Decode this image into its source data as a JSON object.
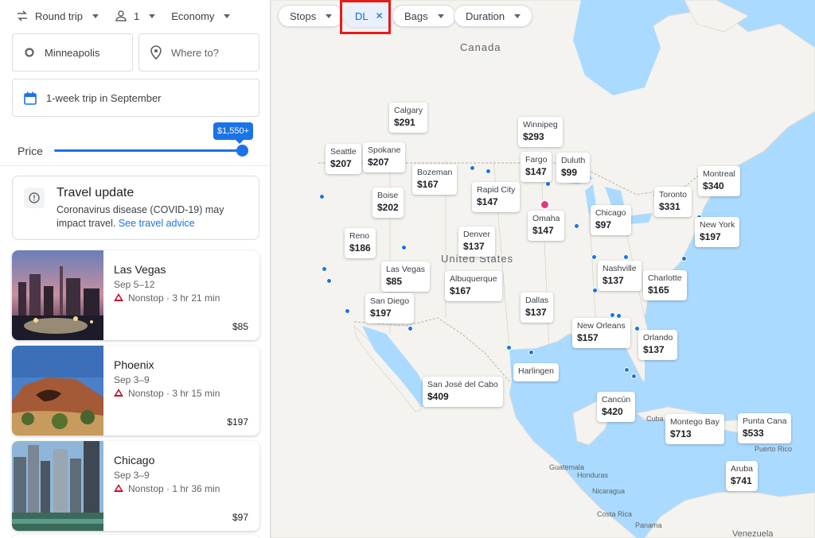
{
  "search": {
    "trip_type": "Round trip",
    "passengers": "1",
    "cabin": "Economy",
    "origin": "Minneapolis",
    "destination_placeholder": "Where to?",
    "dates": "1-week trip in September",
    "price_label": "Price",
    "price_max": "$1,550+"
  },
  "travel_update": {
    "title": "Travel update",
    "body": "Coronavirus disease (COVID-19) may impact travel.",
    "link": "See travel advice"
  },
  "results": [
    {
      "city": "Las Vegas",
      "dates": "Sep 5–12",
      "flight": "Nonstop · 3 hr 21 min",
      "price": "$85"
    },
    {
      "city": "Phoenix",
      "dates": "Sep 3–9",
      "flight": "Nonstop · 3 hr 15 min",
      "price": "$197"
    },
    {
      "city": "Chicago",
      "dates": "Sep 3–9",
      "flight": "Nonstop · 1 hr 36 min",
      "price": "$97"
    }
  ],
  "filters": {
    "stops": "Stops",
    "airline": "DL",
    "bags": "Bags",
    "duration": "Duration"
  },
  "map_labels": {
    "canada": "Canada",
    "us": "United States",
    "cuba": "Cuba",
    "puerto_rico": "Puerto Rico",
    "guatemala": "Guatemala",
    "honduras": "Honduras",
    "nicaragua": "Nicaragua",
    "costa_rica": "Costa Rica",
    "panama": "Panama",
    "venezuela": "Venezuela"
  },
  "destinations": [
    {
      "name": "Calgary",
      "price": "$291"
    },
    {
      "name": "Winnipeg",
      "price": "$293"
    },
    {
      "name": "Seattle",
      "price": "$207"
    },
    {
      "name": "Spokane",
      "price": "$207"
    },
    {
      "name": "Fargo",
      "price": "$147"
    },
    {
      "name": "Duluth",
      "price": "$99"
    },
    {
      "name": "Bozeman",
      "price": "$167"
    },
    {
      "name": "Montreal",
      "price": "$340"
    },
    {
      "name": "Boise",
      "price": "$202"
    },
    {
      "name": "Rapid City",
      "price": "$147"
    },
    {
      "name": "Toronto",
      "price": "$331"
    },
    {
      "name": "Omaha",
      "price": "$147"
    },
    {
      "name": "Chicago",
      "price": "$97"
    },
    {
      "name": "New York",
      "price": "$197"
    },
    {
      "name": "Reno",
      "price": "$186"
    },
    {
      "name": "Denver",
      "price": "$137"
    },
    {
      "name": "Las Vegas",
      "price": "$85"
    },
    {
      "name": "Nashville",
      "price": "$137"
    },
    {
      "name": "Charlotte",
      "price": "$165"
    },
    {
      "name": "Albuquerque",
      "price": "$167"
    },
    {
      "name": "San Diego",
      "price": "$197"
    },
    {
      "name": "Dallas",
      "price": "$137"
    },
    {
      "name": "New Orleans",
      "price": "$157"
    },
    {
      "name": "Orlando",
      "price": "$137"
    },
    {
      "name": "Harlingen",
      "price": ""
    },
    {
      "name": "San José del Cabo",
      "price": "$409"
    },
    {
      "name": "Cancún",
      "price": "$420"
    },
    {
      "name": "Montego Bay",
      "price": "$713"
    },
    {
      "name": "Punta Cana",
      "price": "$533"
    },
    {
      "name": "Aruba",
      "price": "$741"
    }
  ],
  "colors": {
    "accent": "#1a73e8",
    "highlight": "#e81a1a",
    "origin_marker": "#e8377a",
    "water": "#aadaff",
    "land": "#f4f3ef"
  }
}
